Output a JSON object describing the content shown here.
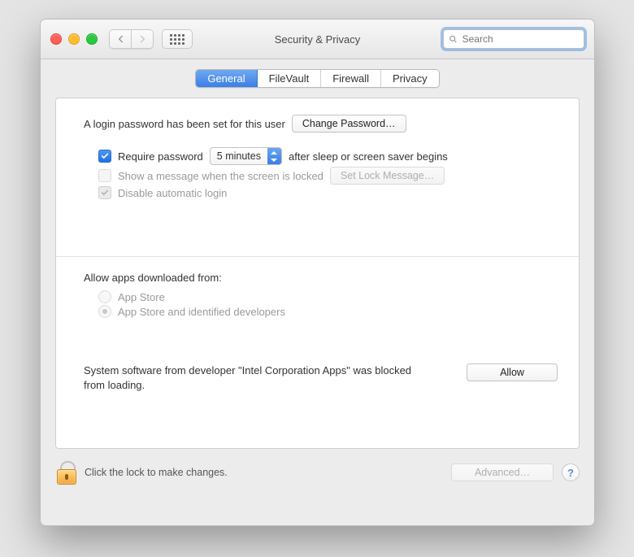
{
  "window": {
    "title": "Security & Privacy"
  },
  "search": {
    "placeholder": "Search"
  },
  "tabs": [
    {
      "label": "General",
      "active": true
    },
    {
      "label": "FileVault",
      "active": false
    },
    {
      "label": "Firewall",
      "active": false
    },
    {
      "label": "Privacy",
      "active": false
    }
  ],
  "general": {
    "login_msg": "A login password has been set for this user",
    "change_password_btn": "Change Password…",
    "require_pw_label": "Require password",
    "require_pw_select": "5 minutes",
    "require_pw_suffix": "after sleep or screen saver begins",
    "show_msg_label": "Show a message when the screen is locked",
    "set_lock_msg_btn": "Set Lock Message…",
    "disable_auto_login_label": "Disable automatic login"
  },
  "gatekeeper": {
    "heading": "Allow apps downloaded from:",
    "opt1": "App Store",
    "opt2": "App Store and identified developers"
  },
  "blocked": {
    "msg": "System software from developer \"Intel Corporation Apps\" was blocked from loading.",
    "allow_btn": "Allow"
  },
  "footer": {
    "lock_msg": "Click the lock to make changes.",
    "advanced_btn": "Advanced…",
    "help": "?"
  }
}
